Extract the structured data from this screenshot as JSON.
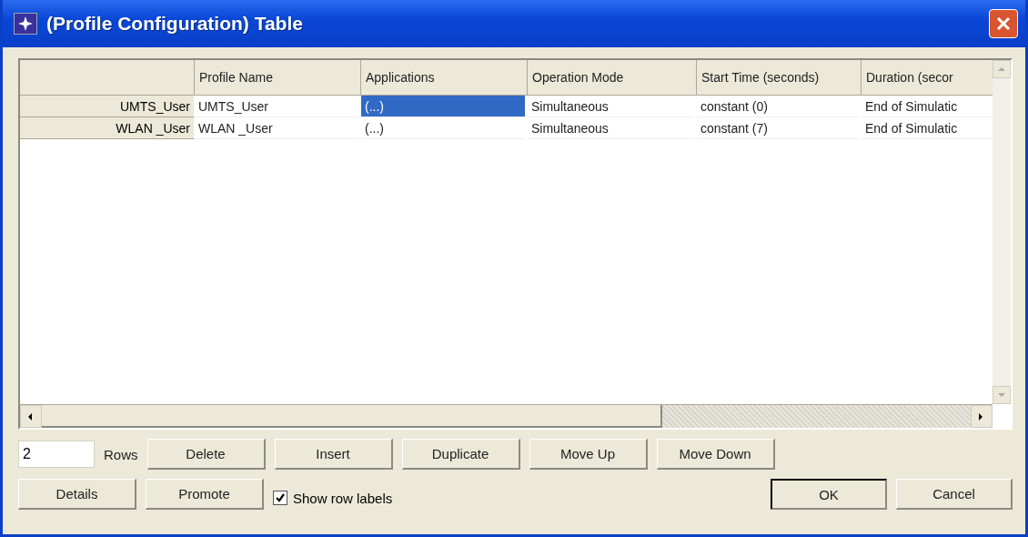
{
  "window": {
    "title": "(Profile Configuration) Table"
  },
  "table": {
    "columns": [
      "Profile Name",
      "Applications",
      "Operation Mode",
      "Start Time (seconds)",
      "Duration (secor"
    ],
    "rows": [
      {
        "label": "UMTS_User",
        "cells": [
          {
            "text": "UMTS_User",
            "selected": false
          },
          {
            "text": "(...)",
            "selected": true
          },
          {
            "text": "Simultaneous",
            "selected": false
          },
          {
            "text": "constant (0)",
            "selected": false
          },
          {
            "text": "End of Simulatic",
            "selected": false
          }
        ]
      },
      {
        "label": "WLAN _User",
        "cells": [
          {
            "text": "WLAN _User",
            "selected": false
          },
          {
            "text": "(...)",
            "selected": false
          },
          {
            "text": "Simultaneous",
            "selected": false
          },
          {
            "text": "constant (7)",
            "selected": false
          },
          {
            "text": "End of Simulatic",
            "selected": false
          }
        ]
      }
    ]
  },
  "rows_field": {
    "value": "2",
    "label": "Rows"
  },
  "row_buttons": [
    "Delete",
    "Insert",
    "Duplicate",
    "Move Up",
    "Move Down"
  ],
  "left_buttons": [
    "Details",
    "Promote"
  ],
  "show_row_labels": {
    "label": "Show row labels",
    "checked": true
  },
  "ok_button": {
    "label": "OK",
    "default": true
  },
  "cancel_button": {
    "label": "Cancel"
  }
}
